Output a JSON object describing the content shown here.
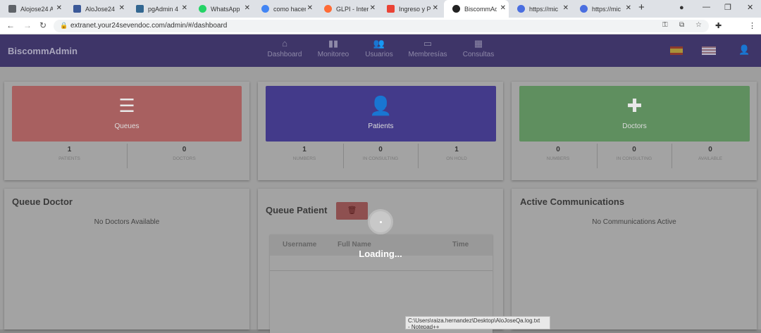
{
  "browser": {
    "tabs": [
      {
        "title": "Alojose24 A",
        "color": "#5f6368",
        "glyph": "▥"
      },
      {
        "title": "AloJose24",
        "color": "#3b5998",
        "glyph": "▧"
      },
      {
        "title": "pgAdmin 4",
        "color": "#336791",
        "glyph": "pg"
      },
      {
        "title": "WhatsApp",
        "color": "#25d366",
        "glyph": "◉"
      },
      {
        "title": "como hacer",
        "color": "#4285f4",
        "glyph": "G"
      },
      {
        "title": "GLPI - Intern",
        "color": "#ff6b35",
        "glyph": "◔"
      },
      {
        "title": "Ingreso y Pr",
        "color": "#ea4335",
        "glyph": "M"
      },
      {
        "title": "BiscommAd",
        "color": "#222222",
        "glyph": "A"
      },
      {
        "title": "https://mic",
        "color": "#4a6ee0",
        "glyph": "∩"
      },
      {
        "title": "https://mic",
        "color": "#4a6ee0",
        "glyph": "∩"
      }
    ],
    "new_tab": "+",
    "url": "extranet.your24sevendoc.com/admin/#/dashboard"
  },
  "app": {
    "brand": "BiscommAdmin",
    "nav": [
      {
        "label": "Dashboard",
        "icon": "⌂"
      },
      {
        "label": "Monitoreo",
        "icon": "▮▮"
      },
      {
        "label": "Usuarios",
        "icon": "👥"
      },
      {
        "label": "Membresías",
        "icon": "▭"
      },
      {
        "label": "Consultas",
        "icon": "▦"
      }
    ]
  },
  "cards": {
    "queues": {
      "label": "Queues",
      "stats": [
        {
          "n": "1",
          "l": "PATIENTS"
        },
        {
          "n": "0",
          "l": "DOCTORS"
        }
      ]
    },
    "patients": {
      "label": "Patients",
      "stats": [
        {
          "n": "1",
          "l": "NUMBERS"
        },
        {
          "n": "0",
          "l": "IN CONSULTING"
        },
        {
          "n": "1",
          "l": "ON HOLD"
        }
      ]
    },
    "doctors": {
      "label": "Doctors",
      "stats": [
        {
          "n": "0",
          "l": "NUMBERS"
        },
        {
          "n": "0",
          "l": "IN CONSULTING"
        },
        {
          "n": "0",
          "l": "AVAILABLE"
        }
      ]
    }
  },
  "queue_doctor": {
    "title": "Queue Doctor",
    "empty": "No Doctors Available"
  },
  "queue_patient": {
    "title": "Queue Patient",
    "columns": [
      "Username",
      "Full Name",
      "Time"
    ]
  },
  "active_comms": {
    "title": "Active Communications",
    "empty": "No Communications Active"
  },
  "overlay": {
    "loading": "Loading..."
  },
  "tooltip": {
    "line1": "C:\\Users\\raiza.hernandez\\Desktop\\AloJoseQa.log.txt",
    "line2": "- Notepad++"
  },
  "colors": {
    "queues": "#a86060",
    "patients": "#433a8a",
    "doctors": "#5f8f5f",
    "appbar": "#3e3568"
  }
}
